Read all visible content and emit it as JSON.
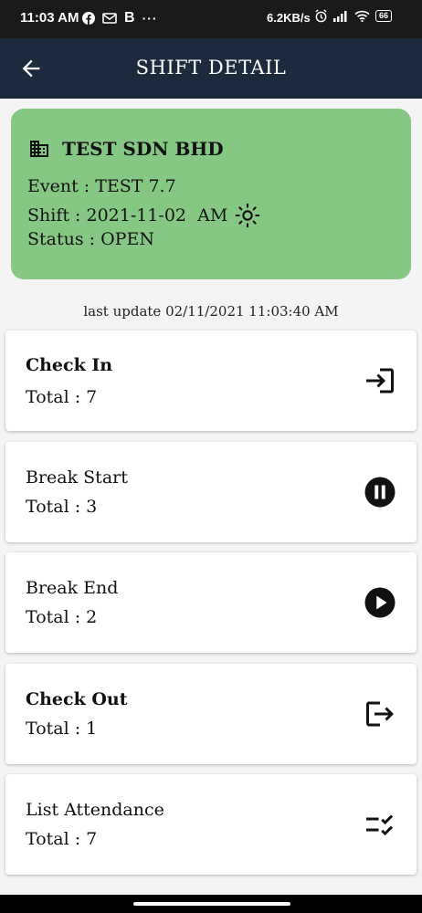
{
  "status_bar": {
    "time": "11:03 AM",
    "app_icons": [
      "facebook-icon",
      "mail-icon",
      "b-icon",
      "more-icon"
    ],
    "b_glyph": "B",
    "more_glyph": "···",
    "network_speed": "6.2KB/s",
    "battery": "66"
  },
  "app_bar": {
    "title": "SHIFT DETAIL",
    "back_icon": "arrow-back-icon"
  },
  "info_card": {
    "company": "TEST SDN BHD",
    "event": "Event : TEST 7.7",
    "shift": "Shift : 2021-11-02  AM",
    "status": "Status : OPEN",
    "background": "#86c883"
  },
  "last_update": "last update 02/11/2021 11:03:40 AM",
  "actions": [
    {
      "label": "Check In",
      "total": "Total : 7",
      "icon": "login-icon"
    },
    {
      "label": "Break Start",
      "total": "Total : 3",
      "icon": "pause-circle-icon"
    },
    {
      "label": "Break End",
      "total": "Total : 2",
      "icon": "play-circle-icon"
    },
    {
      "label": "Check Out",
      "total": "Total : 1",
      "icon": "logout-icon"
    },
    {
      "label": "List Attendance",
      "total": "Total : 7",
      "icon": "checklist-icon"
    }
  ]
}
